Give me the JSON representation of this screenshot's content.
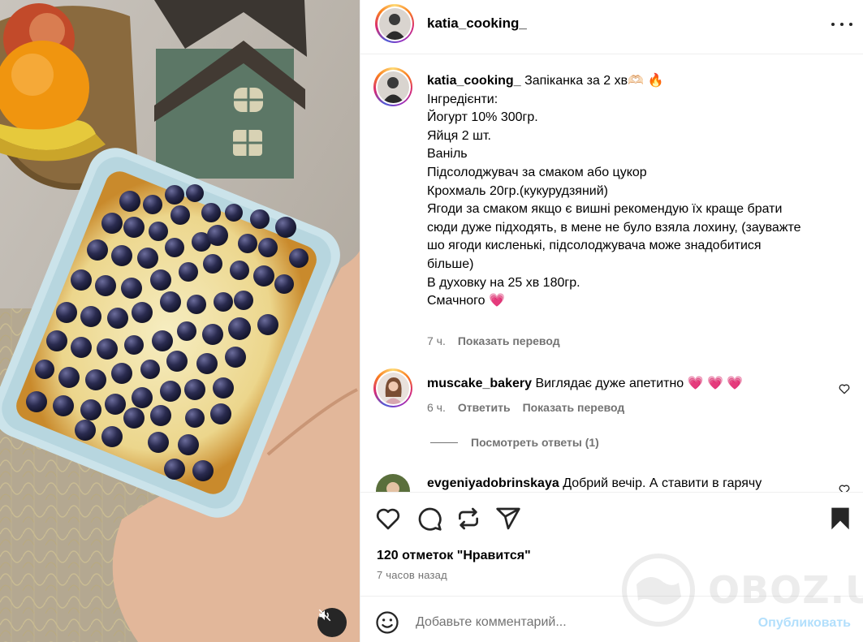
{
  "post": {
    "username": "katia_cooking_",
    "caption_lines": [
      "Запіканка за 2 хв🫶🏻 🔥",
      "",
      "Інгредієнти:",
      "Йогурт 10% 300гр.",
      "Яйця 2 шт.",
      "Ваніль",
      "Підсолоджувач за смаком або цукор",
      "Крохмаль 20гр.(кукурудзяний)",
      "Ягоди за смаком якщо є вишні рекомендую їх краще брати",
      "сюди дуже підходять, в мене не було взяла лохину, (зауважте",
      "шо ягоди кисленькі, підсолоджувача може знадобитися",
      "більше)",
      "В духовку на 25 хв 180гр.",
      "Смачного 💗"
    ],
    "caption_time": "7 ч.",
    "show_translation": "Показать перевод"
  },
  "comments": [
    {
      "username": "muscake_bakery",
      "text": "Виглядає дуже апетитно 💗 💗 💗",
      "time": "6 ч.",
      "reply": "Ответить",
      "translate": "Показать перевод",
      "view_replies": "Посмотреть ответы (1)"
    },
    {
      "username": "evgeniyadobrinskaya",
      "text": "Добрий вечір. А ставити в гарячу"
    }
  ],
  "actions": {
    "icons": [
      "heart-icon",
      "comment-icon",
      "repost-icon",
      "share-icon",
      "bookmark-icon"
    ],
    "likes": "120 отметок \"Нравится\"",
    "time_ago": "7 часов назад"
  },
  "add_comment": {
    "placeholder": "Добавьте комментарий...",
    "post_label": "Опубликовать"
  },
  "watermark": "OBOZ.UA",
  "colors": {
    "post_button": "#b2dffc",
    "secondary_text": "#737373",
    "heart": "#e0245e",
    "divider": "#efefef"
  }
}
